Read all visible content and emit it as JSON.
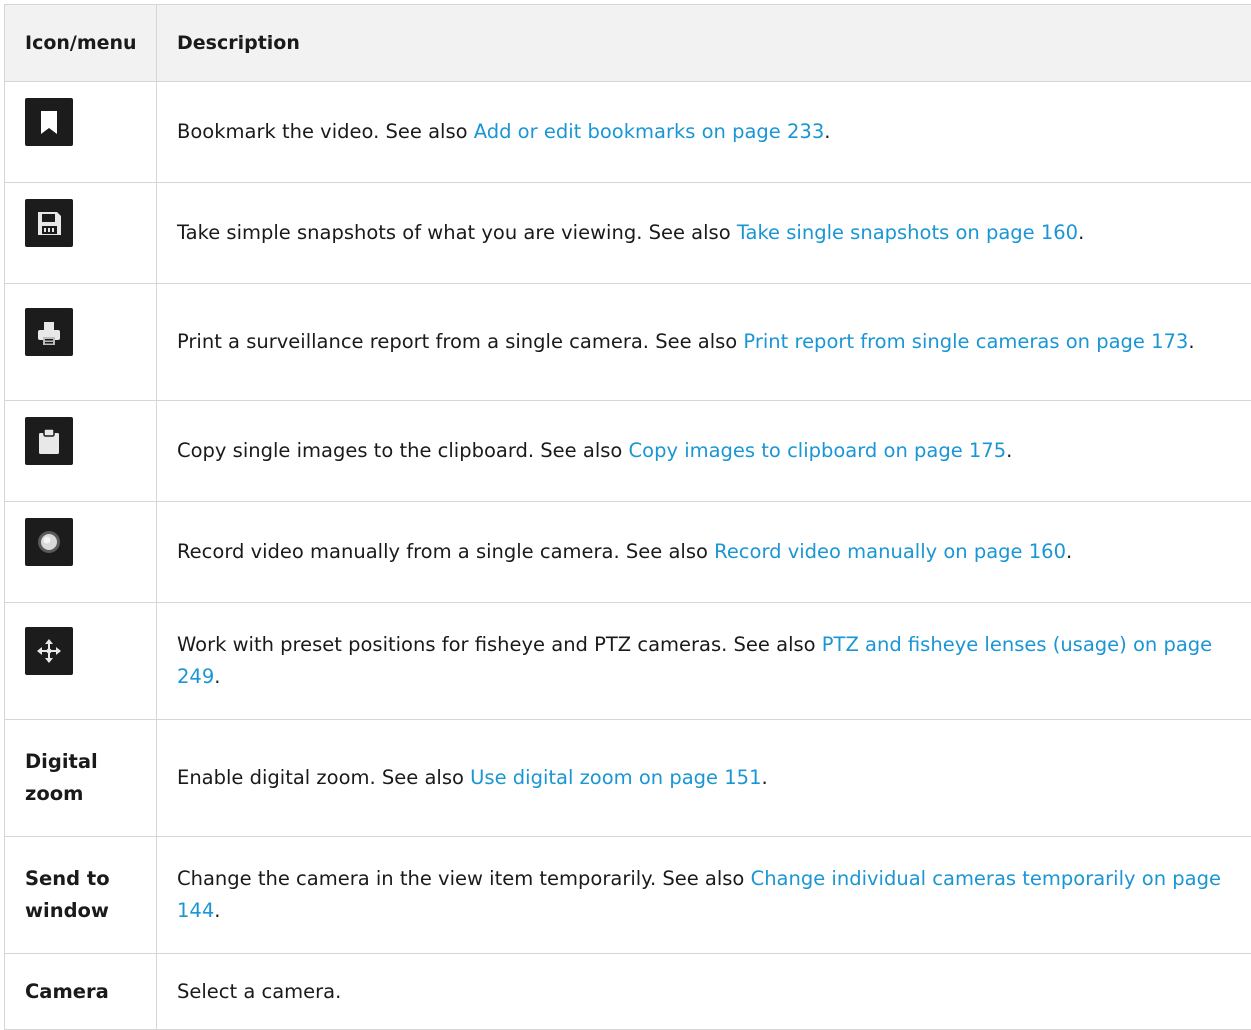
{
  "table": {
    "headers": [
      "Icon/menu",
      "Description"
    ],
    "rows": [
      {
        "icon": "bookmark-icon",
        "label": "",
        "text": "Bookmark the video. See also ",
        "link": "Add or edit bookmarks on page 233",
        "end": "."
      },
      {
        "icon": "save-icon",
        "label": "",
        "text": "Take simple snapshots of what you are viewing. See also ",
        "link": "Take single snapshots on page 160",
        "end": "."
      },
      {
        "icon": "print-icon",
        "label": "",
        "text": "Print a surveillance report from a single camera. See also ",
        "link": "Print report from single cameras on page 173",
        "end": "."
      },
      {
        "icon": "clipboard-icon",
        "label": "",
        "text": "Copy single images to the clipboard. See also ",
        "link": "Copy images to clipboard on page 175",
        "end": "."
      },
      {
        "icon": "record-icon",
        "label": "",
        "text": "Record video manually from a single camera. See also ",
        "link": "Record video manually on page 160",
        "end": "."
      },
      {
        "icon": "ptz-move-icon",
        "label": "",
        "text": "Work with preset positions for fisheye and PTZ cameras. See also ",
        "link": "PTZ and fisheye lenses (usage) on page 249",
        "end": "."
      },
      {
        "icon": "",
        "label": "Digital zoom",
        "text": "Enable digital zoom. See also ",
        "link": "Use digital zoom on page 151",
        "end": "."
      },
      {
        "icon": "",
        "label": "Send to window",
        "text": "Change the camera in the view item temporarily. See also ",
        "link": "Change individual cameras temporarily on page 144",
        "end": "."
      },
      {
        "icon": "",
        "label": "Camera",
        "text": "Select a camera.",
        "link": "",
        "end": ""
      }
    ]
  },
  "colors": {
    "link": "#1a96d4",
    "header_bg": "#f2f2f2",
    "border": "#d6d6d6",
    "icon_bg": "#1c1c1c"
  }
}
